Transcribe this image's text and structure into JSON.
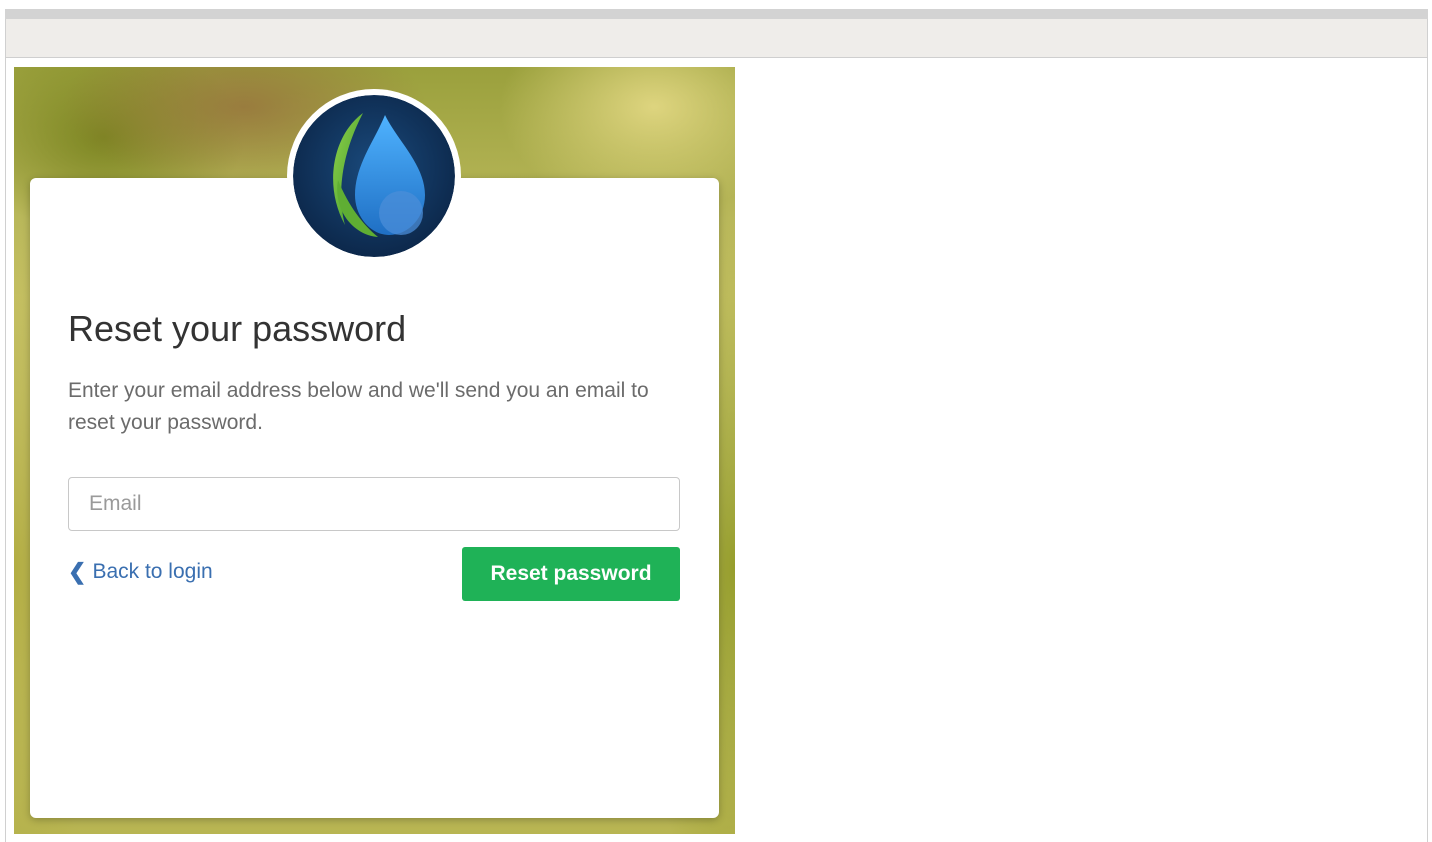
{
  "form": {
    "title": "Reset your password",
    "description": "Enter your email address below and we'll send you an email to reset your password.",
    "email_placeholder": "Email",
    "email_value": "",
    "back_label": "Back to login",
    "back_icon": "chevron-left-icon",
    "reset_button_label": "Reset password"
  },
  "brand": {
    "logo_icon": "water-drop-leaf-logo",
    "logo_bg_color": "#0e2f5a",
    "drop_color": "#2f8fd9",
    "leaf_color": "#6ebf3a"
  },
  "colors": {
    "primary_button": "#1fb257",
    "link": "#3a6fb0"
  }
}
